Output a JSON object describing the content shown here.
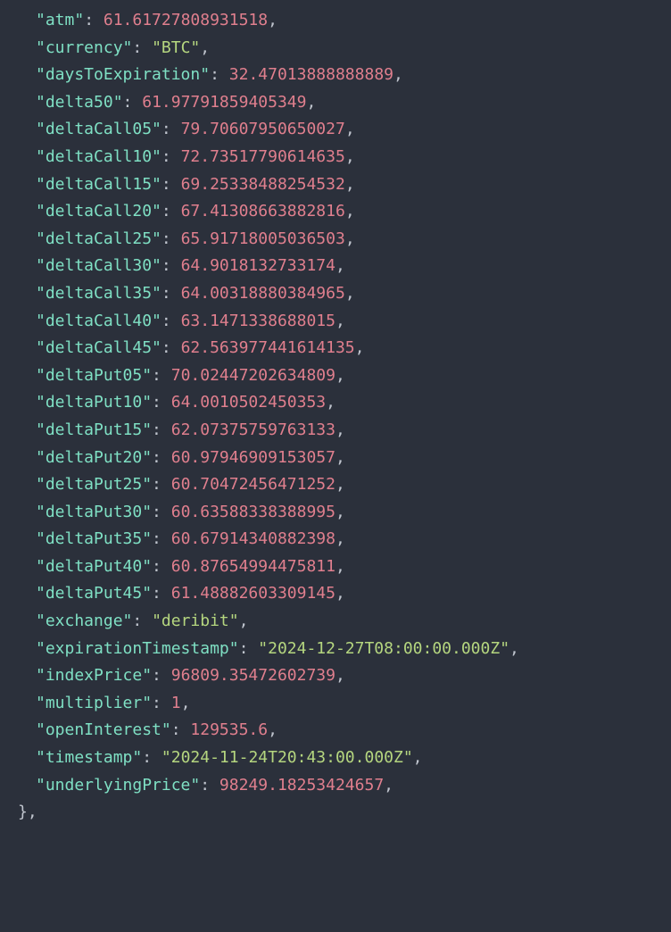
{
  "entries": [
    {
      "key": "atm",
      "type": "num",
      "value": "61.61727808931518"
    },
    {
      "key": "currency",
      "type": "str",
      "value": "BTC"
    },
    {
      "key": "daysToExpiration",
      "type": "num",
      "value": "32.47013888888889"
    },
    {
      "key": "delta50",
      "type": "num",
      "value": "61.97791859405349"
    },
    {
      "key": "deltaCall05",
      "type": "num",
      "value": "79.70607950650027"
    },
    {
      "key": "deltaCall10",
      "type": "num",
      "value": "72.73517790614635"
    },
    {
      "key": "deltaCall15",
      "type": "num",
      "value": "69.25338488254532"
    },
    {
      "key": "deltaCall20",
      "type": "num",
      "value": "67.41308663882816"
    },
    {
      "key": "deltaCall25",
      "type": "num",
      "value": "65.91718005036503"
    },
    {
      "key": "deltaCall30",
      "type": "num",
      "value": "64.9018132733174"
    },
    {
      "key": "deltaCall35",
      "type": "num",
      "value": "64.00318880384965"
    },
    {
      "key": "deltaCall40",
      "type": "num",
      "value": "63.1471338688015"
    },
    {
      "key": "deltaCall45",
      "type": "num",
      "value": "62.563977441614135"
    },
    {
      "key": "deltaPut05",
      "type": "num",
      "value": "70.02447202634809"
    },
    {
      "key": "deltaPut10",
      "type": "num",
      "value": "64.0010502450353"
    },
    {
      "key": "deltaPut15",
      "type": "num",
      "value": "62.07375759763133"
    },
    {
      "key": "deltaPut20",
      "type": "num",
      "value": "60.97946909153057"
    },
    {
      "key": "deltaPut25",
      "type": "num",
      "value": "60.70472456471252"
    },
    {
      "key": "deltaPut30",
      "type": "num",
      "value": "60.63588338388995"
    },
    {
      "key": "deltaPut35",
      "type": "num",
      "value": "60.67914340882398"
    },
    {
      "key": "deltaPut40",
      "type": "num",
      "value": "60.87654994475811"
    },
    {
      "key": "deltaPut45",
      "type": "num",
      "value": "61.48882603309145"
    },
    {
      "key": "exchange",
      "type": "str",
      "value": "deribit"
    },
    {
      "key": "expirationTimestamp",
      "type": "str",
      "value": "2024-12-27T08:00:00.000Z"
    },
    {
      "key": "indexPrice",
      "type": "num",
      "value": "96809.35472602739"
    },
    {
      "key": "multiplier",
      "type": "num",
      "value": "1"
    },
    {
      "key": "openInterest",
      "type": "num",
      "value": "129535.6"
    },
    {
      "key": "timestamp",
      "type": "str",
      "value": "2024-11-24T20:43:00.000Z"
    },
    {
      "key": "underlyingPrice",
      "type": "num",
      "value": "98249.18253424657"
    }
  ],
  "closing": "},"
}
